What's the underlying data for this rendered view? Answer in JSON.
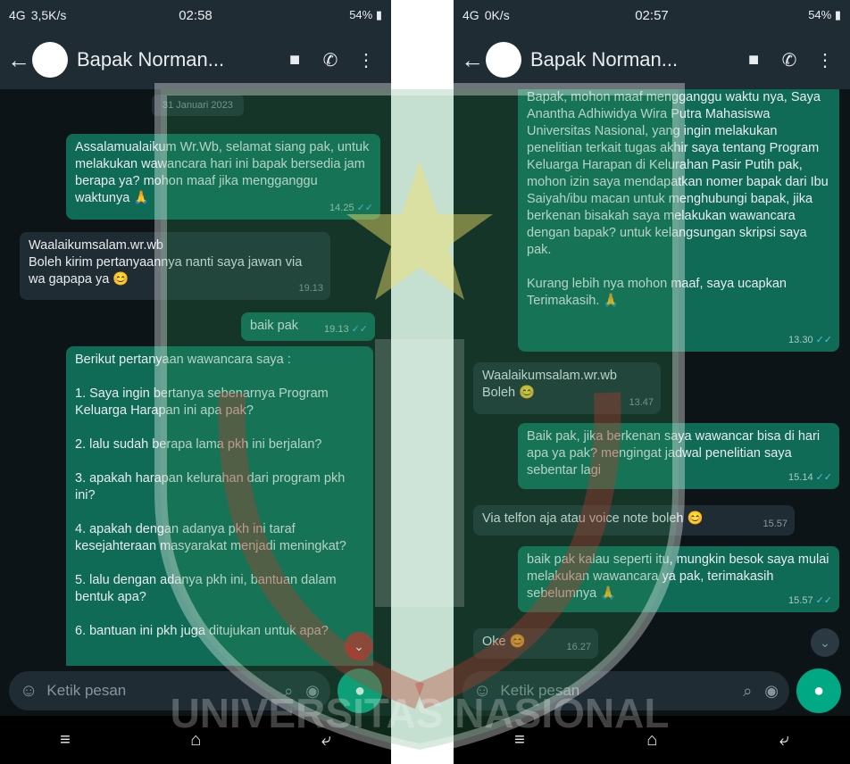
{
  "left": {
    "status": {
      "network": "4G",
      "speed": "3,5K/s",
      "time": "02:58",
      "battery": "54%"
    },
    "contact_name": "Bapak Norman...",
    "date_chip": "31 Januari 2023",
    "messages": [
      {
        "dir": "out",
        "text": "Assalamualaikum Wr.Wb, selamat siang pak, untuk melakukan wawancara hari ini bapak bersedia jam berapa ya? mohon maaf jika mengganggu waktunya 🙏",
        "time": "14.25"
      },
      {
        "dir": "in",
        "text": "Waalaikumsalam.wr.wb\nBoleh kirim pertanyaannya nanti saya jawan via wa gapapa ya 😊",
        "time": "19.13"
      },
      {
        "dir": "out",
        "text": "baik pak",
        "time": "19.13"
      },
      {
        "dir": "out",
        "text": "Berikut pertanyaan wawancara saya :\n\n1. Saya ingin bertanya sebenarnya Program Keluarga Harapan ini apa pak?\n\n2. lalu sudah berapa lama pkh ini berjalan?\n\n3. apakah harapan kelurahan dari program pkh ini?\n\n4. apakah dengan adanya pkh ini taraf kesejahteraan masyarakat menjadi meningkat?\n\n5. lalu dengan adanya pkh ini, bantuan dalam bentuk apa?\n\n6. bantuan ini pkh juga ditujukan untuk apa?",
        "time": ""
      }
    ],
    "input_placeholder": "Ketik pesan"
  },
  "right": {
    "status": {
      "network": "4G",
      "speed": "0K/s",
      "time": "02:57",
      "battery": "54%"
    },
    "contact_name": "Bapak Norman...",
    "messages": [
      {
        "dir": "out",
        "text": "Bapak, mohon maaf mengganggu waktu nya, Saya Anantha Adhiwidya Wira Putra Mahasiswa Universitas Nasional, yang ingin melakukan penelitian terkait tugas akhir saya tentang Program Keluarga Harapan di Kelurahan Pasir Putih pak, mohon izin saya mendapatkan nomer bapak dari Ibu Saiyah/ibu macan untuk menghubungi bapak, jika berkenan bisakah saya melakukan wawancara dengan bapak? untuk kelangsungan skripsi saya pak.\n\nKurang lebih nya mohon maaf, saya ucapkan Terimakasih. 🙏",
        "time": "13.30"
      },
      {
        "dir": "in",
        "text": "Waalaikumsalam.wr.wb\nBoleh 😊",
        "time": "13.47"
      },
      {
        "dir": "out",
        "text": "Baik pak, jika berkenan saya wawancar bisa di hari apa ya pak? mengingat jadwal penelitian saya sebentar lagi",
        "time": "15.14"
      },
      {
        "dir": "in",
        "text": "Via telfon aja atau voice note boleh 😊",
        "time": "15.57"
      },
      {
        "dir": "out",
        "text": "baik pak kalau seperti itu, mungkin besok saya mulai melakukan wawancara ya pak, terimakasih sebelumnya 🙏",
        "time": "15.57"
      },
      {
        "dir": "in",
        "text": "Oke 😊",
        "time": "16.27"
      }
    ],
    "input_placeholder": "Ketik pesan"
  },
  "watermark_text": "UNIVERSITAS NASIONAL",
  "colors": {
    "out_bubble": "#0f6a56",
    "in_bubble": "#1f2c33",
    "accent": "#00a884",
    "tick": "#53bdeb"
  }
}
